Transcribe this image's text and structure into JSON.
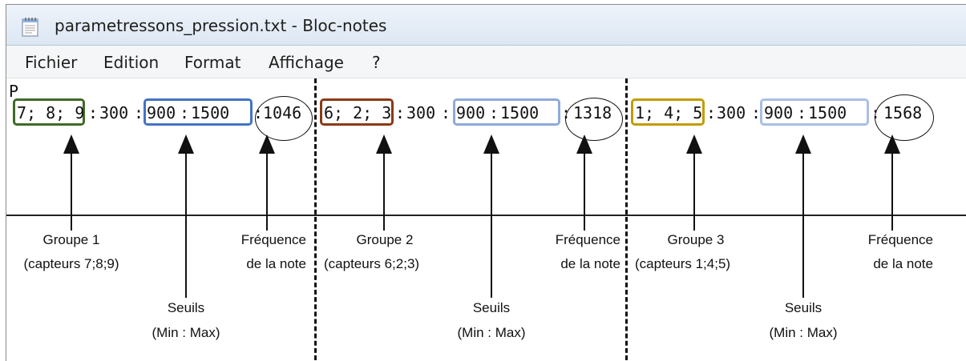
{
  "window": {
    "title": "parametressons_pression.txt - Bloc-notes"
  },
  "menu": {
    "items": [
      "Fichier",
      "Edition",
      "Format",
      "Affichage",
      "?"
    ]
  },
  "editor": {
    "line1": "P",
    "groups": [
      {
        "sensors": "7; 8; 9",
        "gap": "300",
        "min": "900",
        "max": "1500",
        "freq": "1046",
        "border_color": "#3f6a2a",
        "threshold_color": "#4472c4"
      },
      {
        "sensors": "6; 2; 3",
        "gap": "300",
        "min": "900",
        "max": "1500",
        "freq": "1318",
        "border_color": "#8b3a14",
        "threshold_color": "#8eaadb"
      },
      {
        "sensors": "1; 4; 5",
        "gap": "300",
        "min": "900",
        "max": "1500",
        "freq": "1568",
        "border_color": "#c49a00",
        "threshold_color": "#a9bfe3"
      }
    ]
  },
  "annotations": {
    "group1": {
      "title": "Groupe 1",
      "sub": "(capteurs 7;8;9)"
    },
    "group2": {
      "title": "Groupe 2",
      "sub": "(capteurs 6;2;3)"
    },
    "group3": {
      "title": "Groupe 3",
      "sub": "(capteurs 1;4;5)"
    },
    "seuils": {
      "title": "Seuils",
      "sub": "(Min : Max)"
    },
    "frequence": {
      "title": "Fréquence",
      "sub": "de la note"
    }
  }
}
